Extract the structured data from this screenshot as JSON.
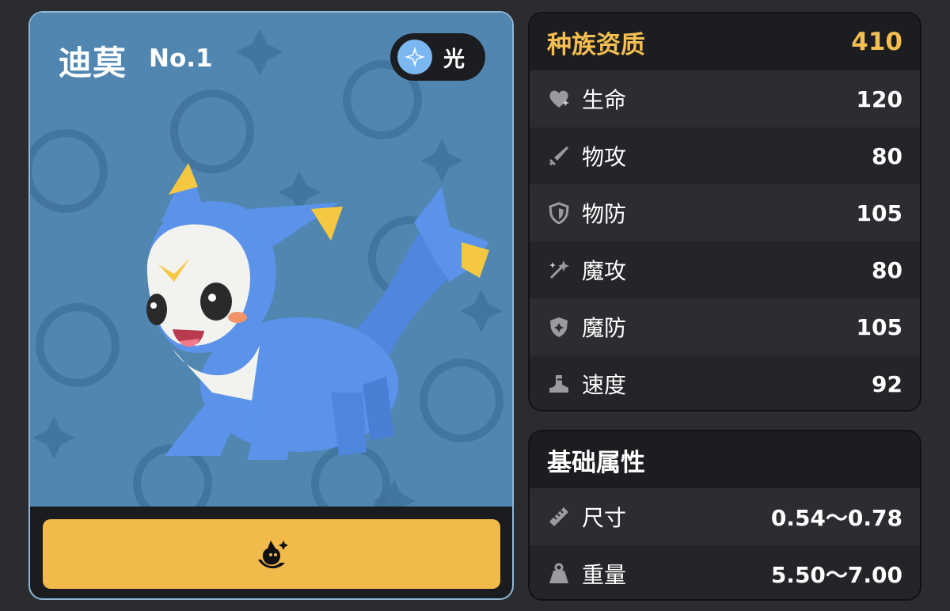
{
  "pet": {
    "name": "迪莫",
    "number": "No.1",
    "element": {
      "label": "光",
      "icon": "light-element-icon"
    }
  },
  "action_button": {
    "icon": "pet-silhouette-icon"
  },
  "species_stats": {
    "title": "种族资质",
    "total": "410",
    "rows": [
      {
        "icon": "heart-icon",
        "label": "生命",
        "value": "120"
      },
      {
        "icon": "sword-icon",
        "label": "物攻",
        "value": "80"
      },
      {
        "icon": "shield-icon",
        "label": "物防",
        "value": "105"
      },
      {
        "icon": "magic-wand-icon",
        "label": "魔攻",
        "value": "80"
      },
      {
        "icon": "magic-shield-icon",
        "label": "魔防",
        "value": "105"
      },
      {
        "icon": "boot-icon",
        "label": "速度",
        "value": "92"
      }
    ]
  },
  "base_attributes": {
    "title": "基础属性",
    "rows": [
      {
        "icon": "ruler-icon",
        "label": "尺寸",
        "value": "0.54～0.78"
      },
      {
        "icon": "weight-icon",
        "label": "重量",
        "value": "5.50～7.00"
      }
    ]
  },
  "colors": {
    "accent": "#f4bf52",
    "card_bg": "#5086b0",
    "card_border": "#8fb6d6",
    "button": "#f2b94b"
  }
}
